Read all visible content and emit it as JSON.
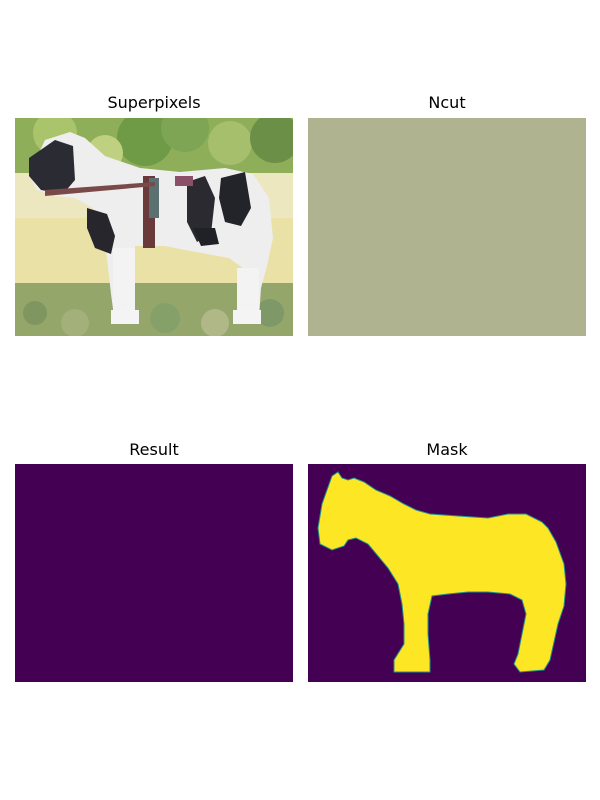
{
  "figure": {
    "panels": [
      {
        "title": "Superpixels"
      },
      {
        "title": "Ncut",
        "fill": "#afb38f"
      },
      {
        "title": "Result",
        "fill": "#440154"
      },
      {
        "title": "Mask",
        "background": "#440154",
        "foreground": "#fde725"
      }
    ]
  }
}
